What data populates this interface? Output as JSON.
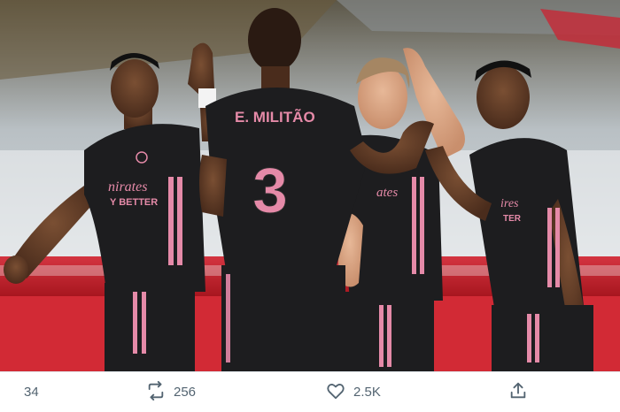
{
  "photo": {
    "description": "Real Madrid players celebrating in black and pink kits",
    "jersey_name": "E. MILITÃO",
    "jersey_number": "3",
    "sponsor_text": "Emirates",
    "sponsor_sub": "FLY BETTER"
  },
  "actions": {
    "reply": {
      "icon": "reply-icon",
      "count": "34"
    },
    "retweet": {
      "icon": "retweet-icon",
      "count": "256"
    },
    "like": {
      "icon": "heart-icon",
      "count": "2.5K"
    },
    "share": {
      "icon": "share-icon"
    }
  },
  "colors": {
    "kit_black": "#1d1d1f",
    "kit_pink": "#e58aa8",
    "ad_board_red": "#c81e2b",
    "icon_gray": "#536471"
  }
}
